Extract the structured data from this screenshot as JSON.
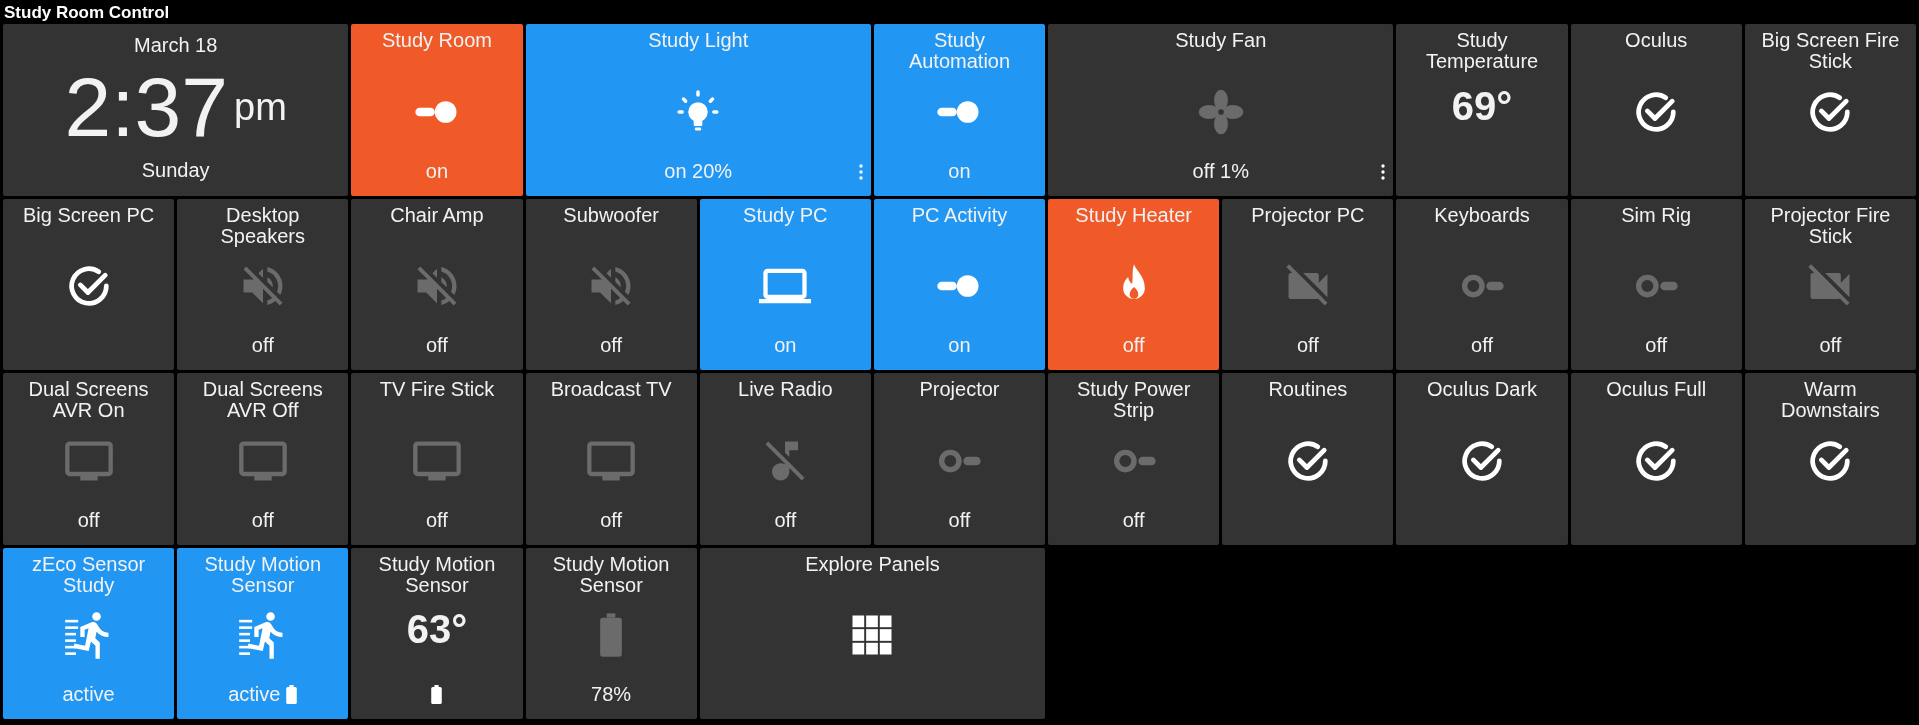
{
  "title": "Study Room Control",
  "tiles": [
    {
      "kind": "clock",
      "date": "March 18",
      "time": "2:37",
      "ampm": "pm",
      "day": "Sunday",
      "color": "#333333"
    },
    {
      "kind": "toggle",
      "label": "Study Room",
      "on": true,
      "status": "on",
      "color": "#f05a28"
    },
    {
      "kind": "bulb",
      "label": "Study Light",
      "on": true,
      "status": "on 20%",
      "menu": true,
      "color": "#2196f3"
    },
    {
      "kind": "toggle",
      "label": "Study Automation",
      "on": true,
      "status": "on",
      "color": "#2196f3"
    },
    {
      "kind": "fan",
      "label": "Study Fan",
      "on": false,
      "status": "off 1%",
      "menu": true,
      "color": "#333333"
    },
    {
      "kind": "temperature",
      "label": "Study Temperature",
      "value": "69°",
      "color": "#333333"
    },
    {
      "kind": "check",
      "label": "Oculus",
      "on": true,
      "color": "#333333"
    },
    {
      "kind": "check",
      "label": "Big Screen Fire Stick",
      "on": true,
      "color": "#333333"
    },
    {
      "kind": "check",
      "label": "Big Screen PC",
      "on": true,
      "color": "#333333"
    },
    {
      "kind": "speaker",
      "label": "Desktop Speakers",
      "on": false,
      "status": "off",
      "color": "#333333"
    },
    {
      "kind": "speaker",
      "label": "Chair Amp",
      "on": false,
      "status": "off",
      "color": "#333333"
    },
    {
      "kind": "speaker",
      "label": "Subwoofer",
      "on": false,
      "status": "off",
      "color": "#333333"
    },
    {
      "kind": "laptop",
      "label": "Study PC",
      "on": true,
      "status": "on",
      "color": "#2196f3"
    },
    {
      "kind": "toggle",
      "label": "PC Activity",
      "on": true,
      "status": "on",
      "color": "#2196f3"
    },
    {
      "kind": "flame",
      "label": "Study Heater",
      "on": true,
      "status": "off",
      "color": "#f05a28"
    },
    {
      "kind": "camera",
      "label": "Projector PC",
      "on": false,
      "status": "off",
      "color": "#333333"
    },
    {
      "kind": "toggle",
      "label": "Keyboards",
      "on": false,
      "status": "off",
      "color": "#333333"
    },
    {
      "kind": "toggle",
      "label": "Sim Rig",
      "on": false,
      "status": "off",
      "color": "#333333"
    },
    {
      "kind": "camera",
      "label": "Projector Fire Stick",
      "on": false,
      "status": "off",
      "color": "#333333"
    },
    {
      "kind": "tv",
      "label": "Dual Screens AVR On",
      "on": false,
      "status": "off",
      "color": "#333333"
    },
    {
      "kind": "tv",
      "label": "Dual Screens AVR Off",
      "on": false,
      "status": "off",
      "color": "#333333"
    },
    {
      "kind": "tv",
      "label": "TV Fire Stick",
      "on": false,
      "status": "off",
      "color": "#333333"
    },
    {
      "kind": "tv",
      "label": "Broadcast TV",
      "on": false,
      "status": "off",
      "color": "#333333"
    },
    {
      "kind": "music",
      "label": "Live Radio",
      "on": false,
      "status": "off",
      "color": "#333333"
    },
    {
      "kind": "toggle",
      "label": "Projector",
      "on": false,
      "status": "off",
      "color": "#333333"
    },
    {
      "kind": "toggle",
      "label": "Study Power Strip",
      "on": false,
      "status": "off",
      "color": "#333333"
    },
    {
      "kind": "check",
      "label": "Routines",
      "on": true,
      "color": "#333333"
    },
    {
      "kind": "check",
      "label": "Oculus Dark",
      "on": true,
      "color": "#333333"
    },
    {
      "kind": "check",
      "label": "Oculus Full",
      "on": true,
      "color": "#333333"
    },
    {
      "kind": "check",
      "label": "Warm Downstairs",
      "on": true,
      "color": "#333333"
    },
    {
      "kind": "motion",
      "label": "zEco Sensor Study",
      "on": true,
      "status": "active",
      "color": "#2196f3"
    },
    {
      "kind": "motion",
      "label": "Study Motion Sensor",
      "on": true,
      "status": "active",
      "battery": true,
      "color": "#2196f3"
    },
    {
      "kind": "temperature",
      "label": "Study Motion Sensor",
      "value": "63°",
      "battery": true,
      "color": "#333333"
    },
    {
      "kind": "battery",
      "label": "Study Motion Sensor",
      "on": false,
      "status": "78%",
      "color": "#333333"
    },
    {
      "kind": "grid",
      "label": "Explore Panels",
      "on": true,
      "color": "#333333"
    }
  ]
}
